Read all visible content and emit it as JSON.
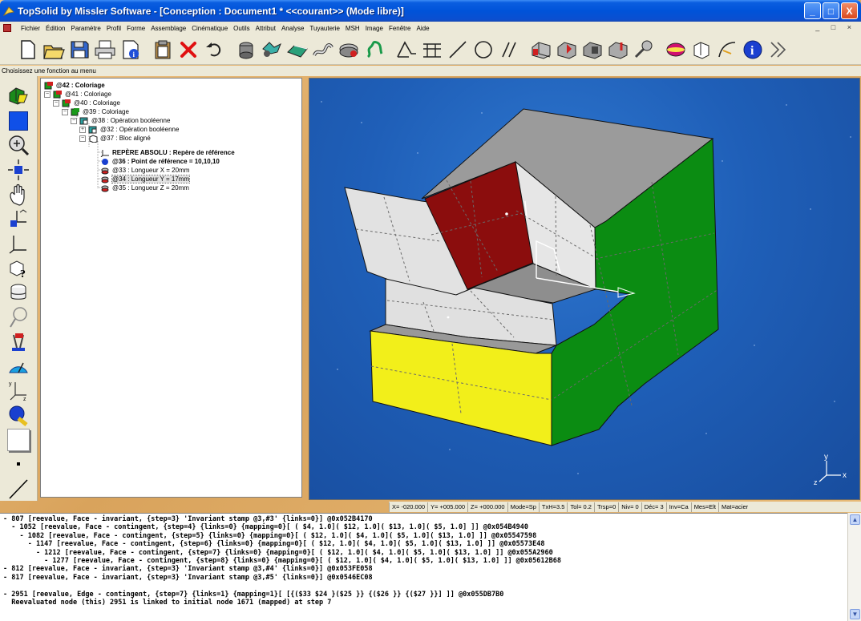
{
  "window": {
    "title": "TopSolid by Missler Software - [Conception : Document1 * <<courant>> (Mode libre)]",
    "buttons": [
      "_",
      "□",
      "X"
    ]
  },
  "menubar": {
    "items": [
      "Fichier",
      "Édition",
      "Paramètre",
      "Profil",
      "Forme",
      "Assemblage",
      "Cinématique",
      "Outils",
      "Attribut",
      "Analyse",
      "Tuyauterie",
      "MSH",
      "Image",
      "Fenêtre",
      "Aide"
    ],
    "mdi_controls": "_ □ ×"
  },
  "toolbar": {
    "icons": [
      "new-doc-icon",
      "open-folder-icon",
      "save-icon",
      "print-icon",
      "properties-icon",
      "clipboard-icon",
      "delete-icon",
      "undo-icon",
      "gear-shape-icon",
      "mechanism-icon",
      "assembly-icon",
      "hose-icon",
      "weld-icon",
      "spring-icon",
      "sketch-icon",
      "surface-icon",
      "line-icon",
      "circle-icon",
      "parallel-icon",
      "feature1-icon",
      "feature2-icon",
      "feature3-icon",
      "feature4-icon",
      "pin-icon",
      "shaded-icon",
      "render-icon",
      "curve-icon",
      "info-icon",
      "forward-icon"
    ]
  },
  "hint": "Choisissez une fonction au menu",
  "left_toolbar": {
    "icons": [
      "part-icon",
      "color-square-icon",
      "zoom-icon",
      "move-icon",
      "hand-icon",
      "axis-icon",
      "frame-icon",
      "query-icon",
      "layers-icon",
      "lasso-icon",
      "tools-icon",
      "measure-icon",
      "coords-icon",
      "paint-icon",
      "blank-icon",
      "point-icon",
      "line-draw-icon"
    ]
  },
  "tree": {
    "rows": [
      {
        "label": "@42 : Coloriage",
        "bold": true
      },
      {
        "label": "@41 : Coloriage"
      },
      {
        "label": "@40 : Coloriage"
      },
      {
        "label": "@39 : Coloriage"
      },
      {
        "label": "@38 : Opération booléenne"
      },
      {
        "label": "@32 : Opération booléenne"
      },
      {
        "label": "@37 : Bloc aligné"
      },
      {
        "label": "REPÈRE ABSOLU : Repère de référence",
        "bold": true
      },
      {
        "label": "@36 : Point de référence = 10,10,10",
        "bold": true
      },
      {
        "label": "@33 : Longueur X = 20mm"
      },
      {
        "label": "@34 : Longueur Y = 17mm",
        "selected": true
      },
      {
        "label": "@35 : Longueur Z = 20mm"
      }
    ]
  },
  "viewport": {
    "axis_labels": {
      "y": "y",
      "z": "z",
      "x": "x"
    },
    "face_colors": {
      "top": "#9a9a9a",
      "green": "#0a8a10",
      "red": "#8c0c0c",
      "yellow": "#f0ee18",
      "white": "#e4e4e4"
    }
  },
  "statusbar": {
    "fields": [
      "X= -020.000",
      "Y= +005.000",
      "Z= +000.000",
      "Mode=Sp",
      "TxH=3.5",
      "Tol= 0.2",
      "Trsp=0",
      "Niv= 0",
      "Déc= 3",
      "Inv=Ca",
      "Mes=Elt",
      "Mat=acier"
    ]
  },
  "console": {
    "lines": [
      "- 807 [reevalue, Face - invariant, {step=3} 'Invariant stamp @3,#3' {links=0}] @0x052B4170",
      "  - 1052 [reevalue, Face - contingent, {step=4} {links=0} {mapping=0}[ ( $4, 1.0]( $12, 1.0]( $13, 1.0]( $5, 1.0] ]] @0x054B4940",
      "    - 1082 [reevalue, Face - contingent, {step=5} {links=0} {mapping=0}[ ( $12, 1.0]( $4, 1.0]( $5, 1.0]( $13, 1.0] ]] @0x05547598",
      "      - 1147 [reevalue, Face - contingent, {step=6} {links=0} {mapping=0}[ ( $12, 1.0]( $4, 1.0]( $5, 1.0]( $13, 1.0] ]] @0x05573E48",
      "        - 1212 [reevalue, Face - contingent, {step=7} {links=0} {mapping=0}[ ( $12, 1.0]( $4, 1.0]( $5, 1.0]( $13, 1.0] ]] @0x055A2960",
      "          - 1277 [reevalue, Face - contingent, {step=8} {links=0} {mapping=0}[ ( $12, 1.0]( $4, 1.0]( $5, 1.0]( $13, 1.0] ]] @0x05612B68",
      "- 812 [reevalue, Face - invariant, {step=3} 'Invariant stamp @3,#4' {links=0}] @0x053FE058",
      "- 817 [reevalue, Face - invariant, {step=3} 'Invariant stamp @3,#5' {links=0}] @0x0546EC08",
      "",
      "- 2951 [reevalue, Edge - contingent, {step=7} {links=1} {mapping=1}[ [{($33 $24 }($25 }} {($26 }} {($27 }}] ]] @0x055DB7B0",
      "  Reevaluated node (this) 2951 is linked to initial node 1671 (mapped) at step 7"
    ]
  }
}
